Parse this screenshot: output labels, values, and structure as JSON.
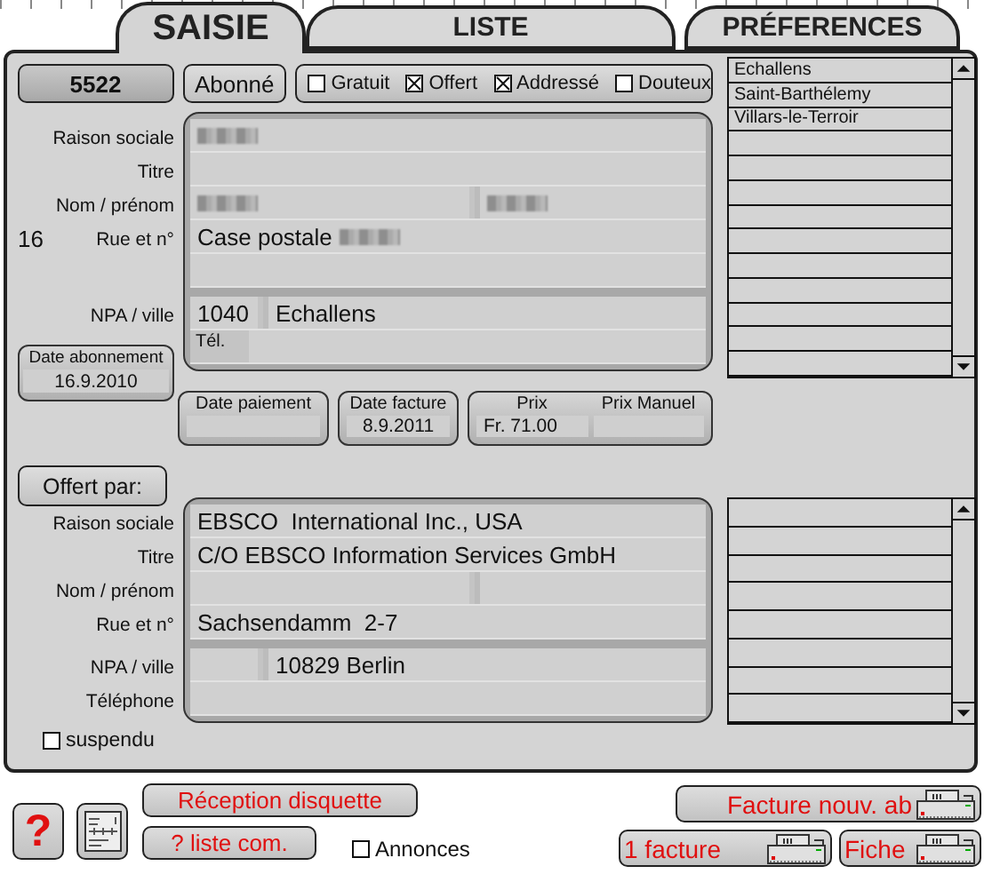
{
  "tabs": [
    {
      "label": "SAISIE",
      "selected": true
    },
    {
      "label": "LISTE",
      "selected": false
    },
    {
      "label": "PRÉFERENCES",
      "selected": false
    }
  ],
  "record": {
    "number": "5522",
    "status": "Abonné",
    "flags": [
      {
        "label": "Gratuit",
        "checked": false
      },
      {
        "label": "Offert",
        "checked": true
      },
      {
        "label": "Addressé",
        "checked": true
      },
      {
        "label": "Douteux",
        "checked": false
      }
    ],
    "subscriber": {
      "rows": [
        {
          "label": "Raison sociale",
          "kind": "single",
          "fields": [
            {
              "redacted": true
            }
          ]
        },
        {
          "label": "Titre",
          "kind": "single",
          "fields": [
            {
              "redacted": false
            }
          ]
        },
        {
          "label": "Nom / prénom",
          "kind": "name",
          "fields": [
            {
              "redacted": true
            },
            {
              "redacted": true
            }
          ]
        },
        {
          "label": "Rue et n°",
          "number": "16",
          "kind": "single",
          "fields": [
            {
              "value": "Case postale",
              "redacted": true
            }
          ]
        },
        {
          "kind": "single",
          "fields": [
            {
              "redacted": false
            }
          ]
        }
      ],
      "locality_rows": [
        {
          "label": "NPA / ville",
          "kind": "locality",
          "fields": [
            {
              "value": "1040",
              "redacted": false
            },
            {
              "value": "Echallens",
              "redacted": false
            }
          ]
        },
        {
          "kind": "phone",
          "inner_label": "Tél.",
          "fields": [
            {
              "redacted": false
            }
          ]
        }
      ]
    },
    "subscription_date": {
      "label": "Date abonnement",
      "value": "16.9.2010"
    },
    "dates": [
      {
        "label": "Date paiement"
      },
      {
        "label": "Date facture",
        "value": "8.9.2011"
      }
    ],
    "price": [
      {
        "label": "Prix",
        "value": "Fr. 71.00"
      },
      {
        "label": "Prix Manuel"
      }
    ],
    "donor": {
      "button": "Offert par:",
      "rows": [
        {
          "label": "Raison sociale",
          "kind": "single",
          "fields": [
            {
              "value": "EBSCO  International Inc., USA",
              "redacted": false
            }
          ]
        },
        {
          "label": "Titre",
          "kind": "single",
          "fields": [
            {
              "value": "C/O EBSCO Information Services GmbH",
              "redacted": false
            }
          ]
        },
        {
          "label": "Nom / prénom",
          "kind": "name",
          "fields": [
            {
              "redacted": false
            },
            {
              "redacted": false
            }
          ]
        },
        {
          "label": "Rue et n°",
          "kind": "single",
          "fields": [
            {
              "value": "Sachsendamm  2-7",
              "redacted": false
            }
          ]
        }
      ],
      "locality_rows": [
        {
          "label": "NPA / ville",
          "kind": "locality",
          "fields": [
            {
              "redacted": false
            },
            {
              "value": "10829 Berlin",
              "redacted": false
            }
          ]
        },
        {
          "label": "Téléphone",
          "kind": "single",
          "fields": [
            {
              "redacted": false
            }
          ]
        }
      ]
    },
    "suspended": {
      "label": "suspendu",
      "checked": false
    },
    "localities": {
      "items": [
        "Echallens",
        "Saint-Barthélemy",
        "Villars-le-Terroir"
      ]
    }
  },
  "actions": {
    "help": "?",
    "reception": "Réception disquette",
    "list": "? liste com.",
    "ads": {
      "label": "Annonces",
      "checked": false
    },
    "new_invoice": "Facture nouv. ab",
    "one_invoice": "1 facture",
    "card": "Fiche"
  }
}
